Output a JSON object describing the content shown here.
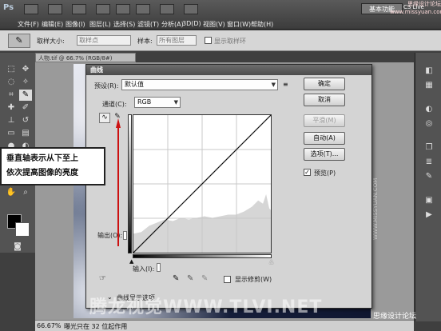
{
  "app": {
    "logo": "Ps",
    "workspace_button": "基本功能",
    "cs_live": "CS Live",
    "watermark_top": "思缘设计论坛 www.missyuan.com"
  },
  "menu": [
    "文件(F)",
    "编辑(E)",
    "图像(I)",
    "图层(L)",
    "选择(S)",
    "滤镜(T)",
    "分析(A)",
    "3D(D)",
    "视图(V)",
    "窗口(W)",
    "帮助(H)"
  ],
  "options_bar": {
    "sample_size_label": "取样大小:",
    "sample_size_value": "取样点",
    "sample_label": "样本:",
    "sample_value": "所有图层",
    "show_ring_label": "显示取样环"
  },
  "document": {
    "tab_title": "人物.tif @ 66.7% (RGB/8#)",
    "zoom": "66.67%",
    "status": "曝光只在 32 位起作用"
  },
  "dialog": {
    "title": "曲线",
    "preset_label": "预设(R):",
    "preset_value": "默认值",
    "channel_label": "通道(C):",
    "channel_value": "RGB",
    "output_label": "输出(O):",
    "input_label": "输入(I):",
    "show_clipping_label": "显示修剪(W)",
    "curve_options_label": "曲线显示选项",
    "buttons": {
      "ok": "确定",
      "cancel": "取消",
      "smooth": "平滑(M)",
      "auto": "自动(A)",
      "options": "选项(T)...",
      "preview": "预览(P)"
    },
    "preview_checked": true
  },
  "callout": {
    "line1": "垂直轴表示从下至上",
    "line2": "依次提高图像的亮度"
  },
  "watermark_bottom": "腾龙视觉WWW.TLVI.NET",
  "watermark_bottom_right": "思缘设计论坛",
  "watermark_side": "WWW.MISSYUAN.COM",
  "colors": {
    "accent_arrow": "#cc1111",
    "dialog_title": "#555555"
  }
}
